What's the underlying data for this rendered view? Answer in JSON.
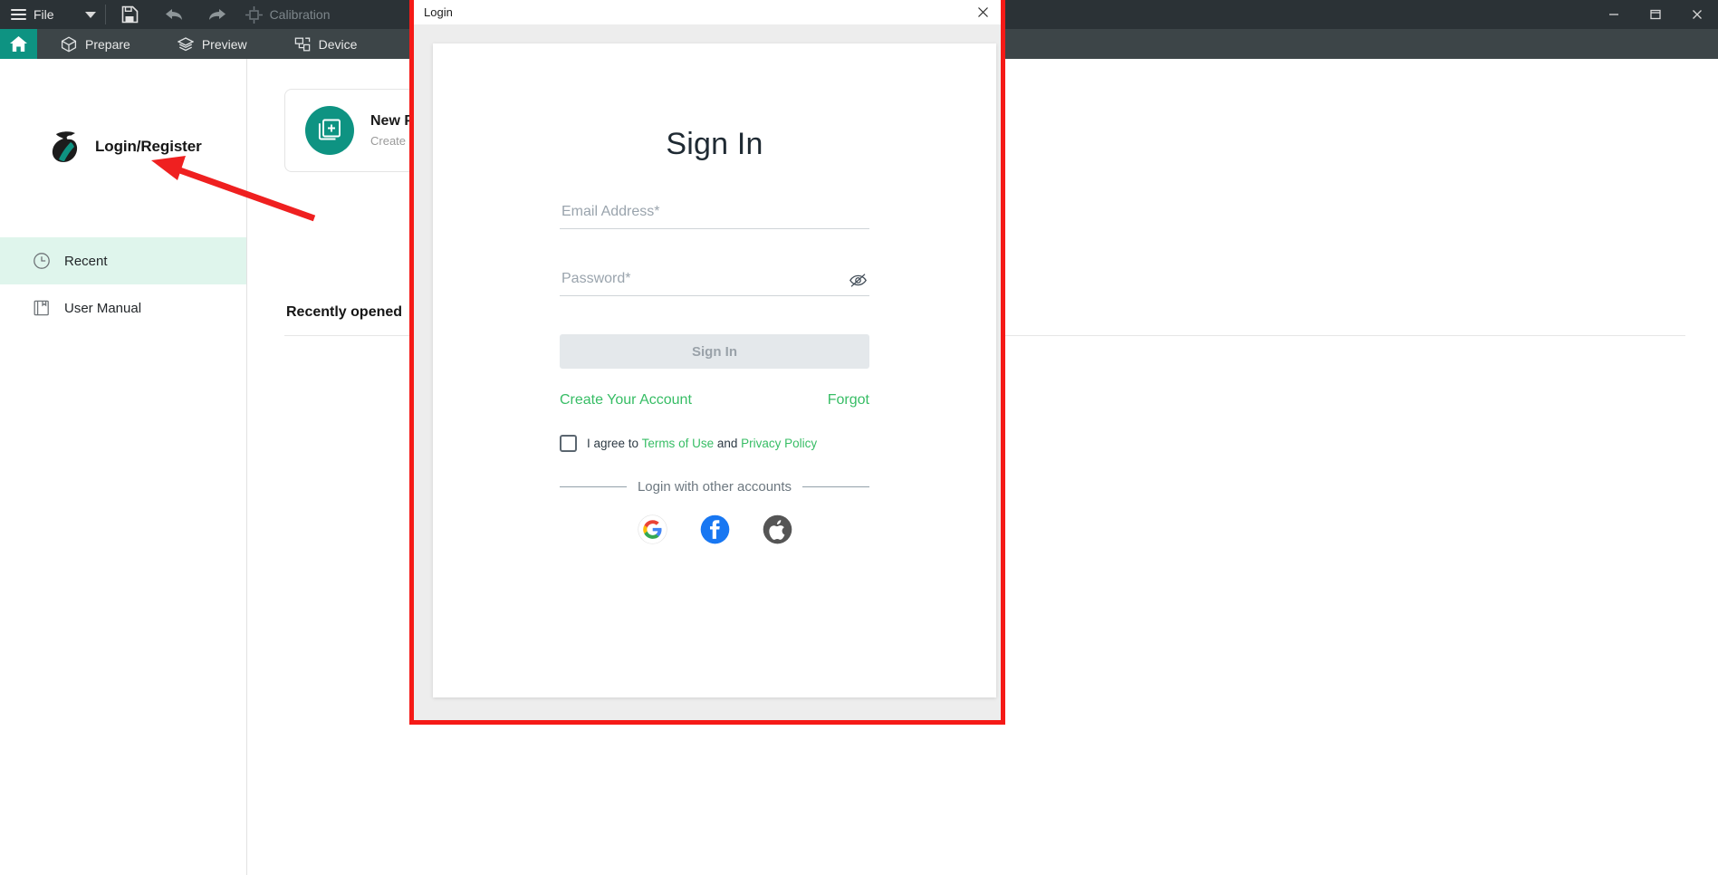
{
  "window": {
    "minimize_label": "Minimize",
    "maximize_label": "Maximize",
    "close_label": "Close"
  },
  "toolbar": {
    "file_label": "File",
    "dropdown_icon": "chevron-down-icon",
    "save_icon": "save-icon",
    "undo_icon": "undo-icon",
    "redo_icon": "redo-icon",
    "calibration_label": "Calibration",
    "calibration_icon": "calibration-icon"
  },
  "ribbon": {
    "home_icon": "home-icon",
    "items": [
      {
        "label": "Prepare",
        "icon": "cube-icon"
      },
      {
        "label": "Preview",
        "icon": "layers-icon"
      },
      {
        "label": "Device",
        "icon": "device-icon"
      }
    ]
  },
  "sidebar": {
    "brand": {
      "logo_icon": "bird-logo-icon",
      "label": "Login/Register"
    },
    "items": [
      {
        "label": "Recent",
        "icon": "clock-icon",
        "active": true
      },
      {
        "label": "User Manual",
        "icon": "book-icon",
        "active": false
      }
    ]
  },
  "main": {
    "new_card": {
      "icon": "new-project-icon",
      "title": "New P",
      "subtitle": "Create"
    },
    "recently_opened_label": "Recently opened"
  },
  "annotation": {
    "arrow": "red-arrow-pointing-to-login-register"
  },
  "modal": {
    "title": "Login",
    "close_icon": "close-icon",
    "heading": "Sign In",
    "email": {
      "placeholder": "Email Address*",
      "value": ""
    },
    "password": {
      "placeholder": "Password*",
      "value": "",
      "toggle_icon": "eye-off-icon"
    },
    "submit_label": "Sign In",
    "create_account_label": "Create Your Account",
    "forgot_label": "Forgot",
    "agree": {
      "prefix": "I agree to",
      "terms_label": "Terms of Use",
      "conjunction": "and",
      "privacy_label": "Privacy Policy",
      "checked": false
    },
    "other_accounts_label": "Login with other accounts",
    "social_logins": [
      {
        "name": "google-icon",
        "label": "Google"
      },
      {
        "name": "facebook-icon",
        "label": "Facebook"
      },
      {
        "name": "apple-icon",
        "label": "Apple"
      }
    ]
  },
  "colors": {
    "accent_teal": "#0e9382",
    "link_green": "#37bd65",
    "annotation_red": "#f51a17",
    "toolbar_dark": "#2b3236",
    "ribbon_dark": "#3d4548",
    "active_item": "#dff5ec"
  }
}
